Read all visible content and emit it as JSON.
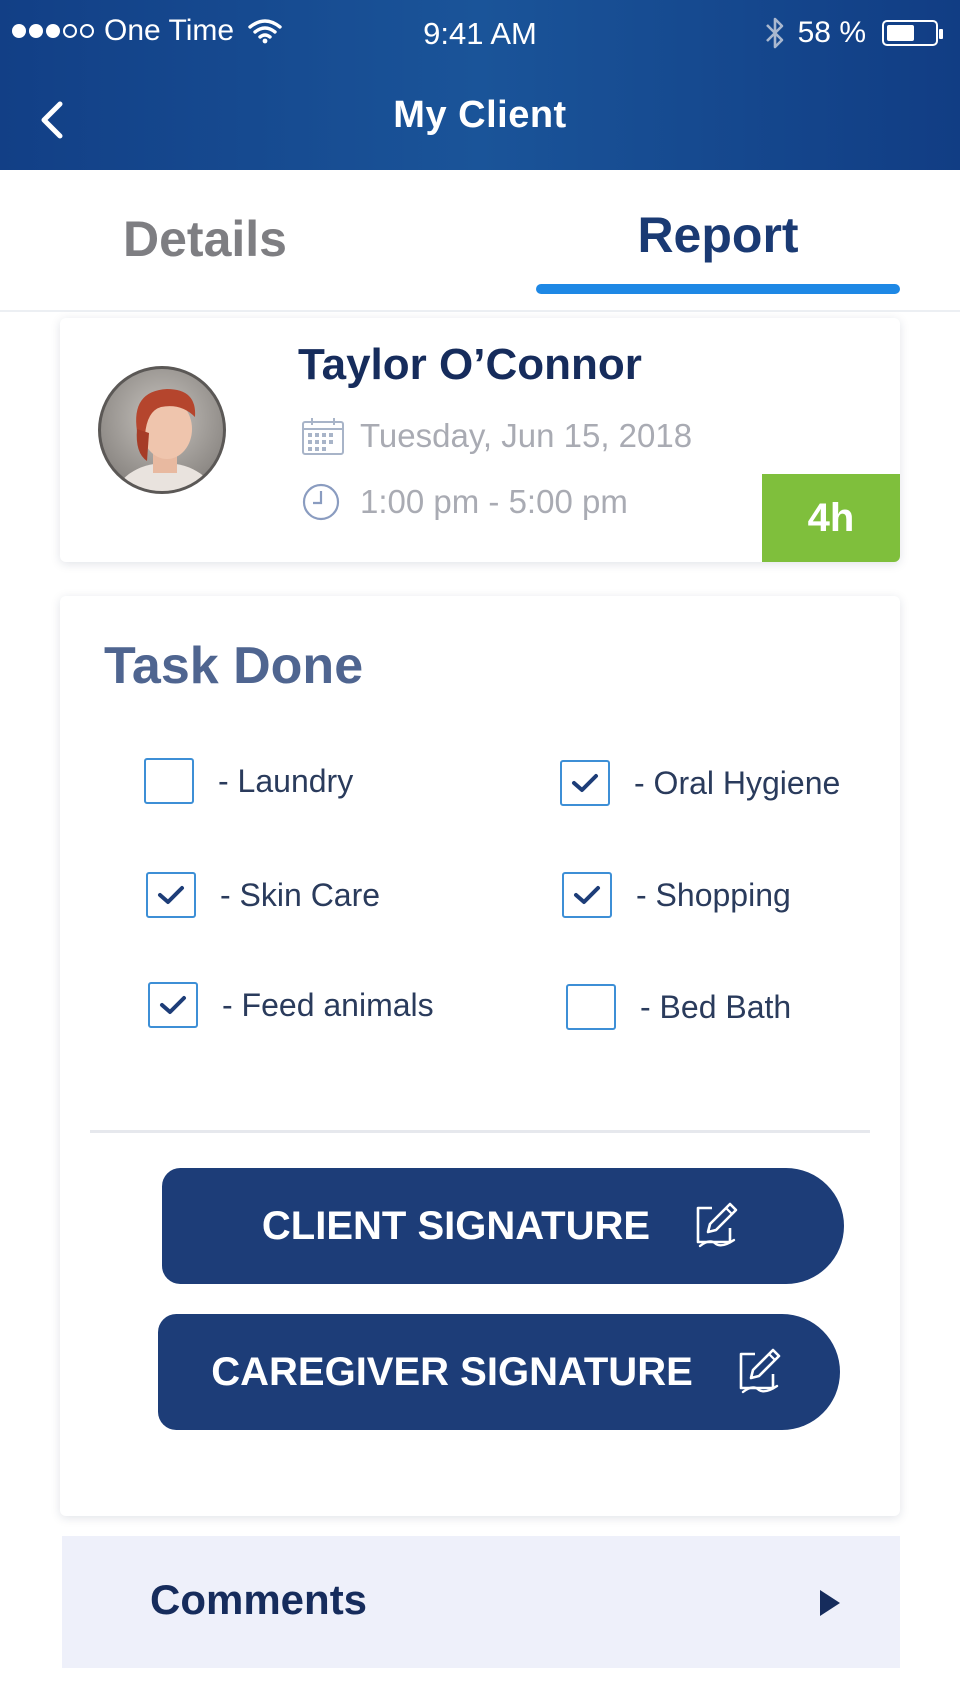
{
  "status_bar": {
    "carrier": "One Time",
    "time": "9:41 AM",
    "battery": "58 %",
    "battery_level": 0.58
  },
  "nav": {
    "title": "My Client"
  },
  "tabs": [
    {
      "label": "Details",
      "active": false
    },
    {
      "label": "Report",
      "active": true
    }
  ],
  "client": {
    "name": "Taylor O’Connor",
    "date": "Tuesday, Jun 15, 2018",
    "time_range": "1:00 pm - 5:00 pm",
    "duration": "4h"
  },
  "tasks": {
    "title": "Task Done",
    "items": [
      {
        "label": "- Laundry",
        "checked": false
      },
      {
        "label": "- Oral Hygiene",
        "checked": true
      },
      {
        "label": "- Skin Care",
        "checked": true
      },
      {
        "label": "- Shopping",
        "checked": true
      },
      {
        "label": "- Feed animals",
        "checked": true
      },
      {
        "label": "- Bed Bath",
        "checked": false
      }
    ]
  },
  "buttons": {
    "client_signature": "CLIENT SIGNATURE",
    "caregiver_signature": "CAREGIVER SIGNATURE"
  },
  "comments": {
    "label": "Comments"
  },
  "colors": {
    "header": "#1a5499",
    "accent_blue": "#1e88e5",
    "navy": "#1d3d78",
    "duration_green": "#7fbf3c"
  }
}
